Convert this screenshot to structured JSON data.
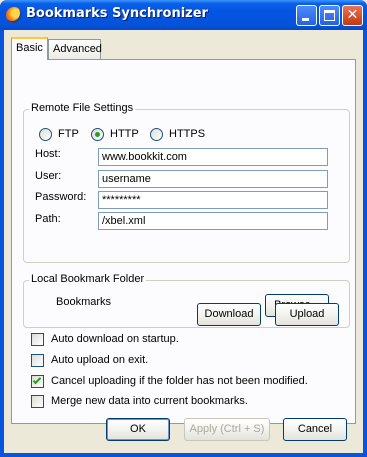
{
  "window": {
    "title": "Bookmarks Synchronizer"
  },
  "tabs": [
    {
      "label": "Basic",
      "active": true
    },
    {
      "label": "Advanced",
      "active": false
    }
  ],
  "remote": {
    "legend": "Remote File Settings",
    "protocols": [
      {
        "label": "FTP",
        "checked": false
      },
      {
        "label": "HTTP",
        "checked": true
      },
      {
        "label": "HTTPS",
        "checked": false
      }
    ],
    "host_label": "Host:",
    "host_value": "www.bookkit.com",
    "user_label": "User:",
    "user_value": "username",
    "password_label": "Password:",
    "password_value": "*********",
    "path_label": "Path:",
    "path_value": "/xbel.xml"
  },
  "local": {
    "legend": "Local Bookmark Folder",
    "folder": "Bookmarks",
    "browse_label": "Browse..."
  },
  "actions": {
    "download_label": "Download",
    "upload_label": "Upload"
  },
  "options": [
    {
      "label": "Auto download on startup.",
      "checked": false
    },
    {
      "label": "Auto upload on exit.",
      "checked": false
    },
    {
      "label": "Cancel uploading if the folder has not been modified.",
      "checked": true
    },
    {
      "label": "Merge new data into current bookmarks.",
      "checked": false
    }
  ],
  "footer": {
    "ok_label": "OK",
    "apply_label": "Apply (Ctrl + S)",
    "cancel_label": "Cancel"
  },
  "colors": {
    "titlebar": "#0554e3",
    "accent_check": "#21a121",
    "tab_highlight": "#ffc83c"
  }
}
